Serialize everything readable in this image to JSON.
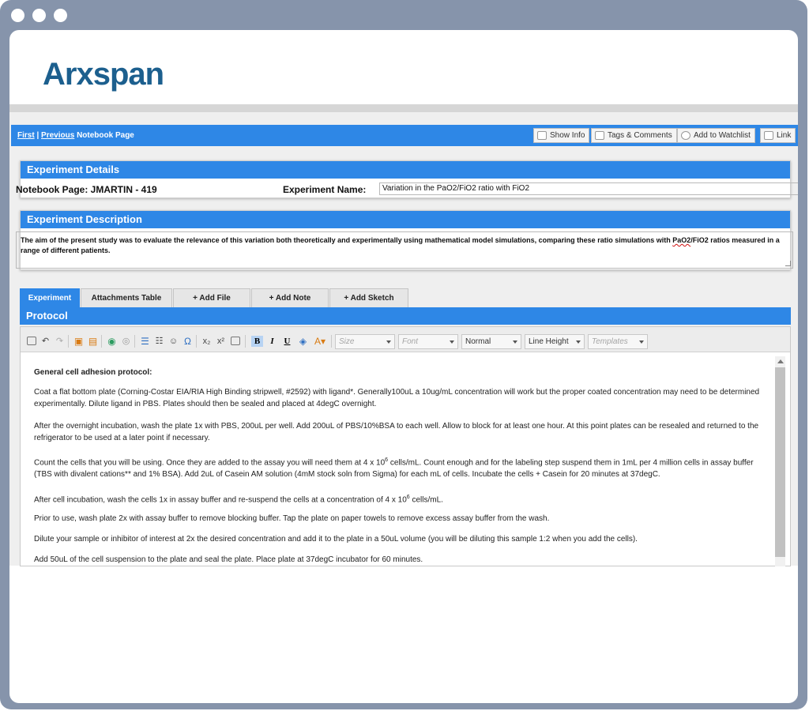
{
  "app": {
    "logo": "Arxspan"
  },
  "nav": {
    "first": "First",
    "sep": "|",
    "previous": "Previous",
    "suffix": "Notebook Page",
    "buttons": {
      "show_info": "Show Info",
      "tags": "Tags & Comments",
      "watchlist": "Add to Watchlist",
      "link": "Link"
    }
  },
  "details": {
    "title": "Experiment Details",
    "notebook_label": "Notebook Page: JMARTIN - 419",
    "name_label": "Experiment Name:",
    "name_value": "Variation in the PaO2/FiO2 ratio with FiO2"
  },
  "description": {
    "title": "Experiment Description",
    "text_before": "The aim of the present study was to evaluate the relevance of this variation both theoretically and experimentally using mathematical model simulations, comparing these ratio simulations with ",
    "text_flagged": "PaO2",
    "text_after": "/FiO2 ratios measured in a range of different patients."
  },
  "tabs": [
    "Experiment",
    "Attachments Table",
    "+ Add File",
    "+ Add Note",
    "+ Add Sketch"
  ],
  "protocol": {
    "title": "Protocol",
    "toolbar": {
      "size": "Size",
      "font": "Font",
      "format": "Normal",
      "line_height": "Line Height",
      "templates": "Templates",
      "bold": "B",
      "italic": "I",
      "underline": "U",
      "omega": "Ω",
      "subscript": "x₂",
      "superscript": "x²"
    },
    "content": {
      "heading": "General cell adhesion protocol:",
      "p1": "Coat a flat bottom plate (Corning-Costar EIA/RIA High Binding stripwell, #2592) with ligand*. Generally100uL a 10ug/mL concentration will work but the proper coated concentration may need to be determined experimentally. Dilute ligand in PBS. Plates should then be sealed and placed at 4degC overnight.",
      "p2": "After the overnight incubation, wash the plate 1x with PBS, 200uL per well. Add 200uL of PBS/10%BSA to each well. Allow to block for at least one hour. At this point plates can be resealed and returned to the refrigerator to be used at a later point if necessary.",
      "p3a": "Count the cells that you will be using. Once they are added to the assay you will need them at 4 x 10",
      "p3sup": "6",
      "p3b": " cells/mL. Count enough and for the labeling step suspend them in 1mL per 4 million cells in assay buffer (TBS with divalent cations** and 1% BSA). Add 2uL of Casein AM solution (4mM stock soln from Sigma) for each mL of cells. Incubate the cells + Casein for 20 minutes at 37degC.",
      "p4a": "After cell incubation, wash the cells 1x in assay buffer and re-suspend the cells at a concentration of 4 x 10",
      "p4sup": "6",
      "p4b": " cells/mL.",
      "p5": "Prior to use, wash plate 2x with assay buffer to remove blocking buffer. Tap the plate on paper towels to remove excess assay buffer from the wash.",
      "p6": "Dilute your sample or inhibitor of interest at 2x the desired concentration and add it to the plate in a 50uL volume (you will be diluting this sample 1:2 when you add the cells).",
      "p7": "Add 50uL of the cell suspension to the plate and seal the plate. Place plate at 37degC incubator for 60 minutes."
    }
  }
}
